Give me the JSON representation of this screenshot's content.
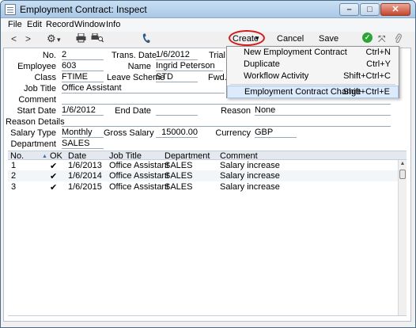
{
  "window": {
    "title": "Employment Contract: Inspect"
  },
  "menubar": {
    "items": [
      "File",
      "Edit",
      "Record",
      "Window",
      "Info"
    ]
  },
  "toolbar": {
    "prev": "<",
    "next": ">",
    "gear_arrow": "▾",
    "create": "Create",
    "create_arrow": "▾",
    "cancel": "Cancel",
    "save": "Save"
  },
  "icons": {
    "ok": "ok-icon"
  },
  "form": {
    "no": {
      "label": "No.",
      "value": "2"
    },
    "trans_date": {
      "label": "Trans. Date",
      "value": "1/6/2012"
    },
    "trial": {
      "label": "Trial"
    },
    "employee": {
      "label": "Employee",
      "value": "603"
    },
    "name": {
      "label": "Name",
      "value": "Ingrid Peterson"
    },
    "class": {
      "label": "Class",
      "value": "FTIME"
    },
    "leave_scheme": {
      "label": "Leave Scheme",
      "value": "STD"
    },
    "fwd": {
      "label": "Fwd."
    },
    "job_title": {
      "label": "Job Title",
      "value": "Office Assistant"
    },
    "comment": {
      "label": "Comment",
      "value": ""
    },
    "start_date": {
      "label": "Start Date",
      "value": "1/6/2012"
    },
    "end_date": {
      "label": "End Date",
      "value": ""
    },
    "reason": {
      "label": "Reason",
      "value": "None"
    },
    "reason_details": {
      "label": "Reason Details",
      "value": ""
    },
    "salary_type": {
      "label": "Salary Type",
      "value": "Monthly"
    },
    "gross_salary": {
      "label": "Gross Salary",
      "value": "15000.00"
    },
    "currency": {
      "label": "Currency",
      "value": "GBP"
    },
    "department": {
      "label": "Department",
      "value": "SALES"
    }
  },
  "create_menu": {
    "items": [
      {
        "label": "New Employment Contract",
        "shortcut": "Ctrl+N"
      },
      {
        "label": "Duplicate",
        "shortcut": "Ctrl+Y"
      },
      {
        "label": "Workflow Activity",
        "shortcut": "Shift+Ctrl+C"
      },
      {
        "label": "Employment Contract Change",
        "shortcut": "Shift+Ctrl+E"
      }
    ]
  },
  "grid": {
    "columns": [
      "No.",
      "OK",
      "Date",
      "Job Title",
      "Department",
      "Comment"
    ],
    "sort_arrow": "▲",
    "rows": [
      {
        "no": "1",
        "ok": "✔",
        "date": "1/6/2013",
        "job_title": "Office Assistant",
        "department": "SALES",
        "comment": "Salary increase"
      },
      {
        "no": "2",
        "ok": "✔",
        "date": "1/6/2014",
        "job_title": "Office Assistant",
        "department": "SALES",
        "comment": "Salary increase"
      },
      {
        "no": "3",
        "ok": "✔",
        "date": "1/6/2015",
        "job_title": "Office Assistant",
        "department": "SALES",
        "comment": "Salary increase"
      }
    ]
  },
  "scrollbar": {
    "up": "▲"
  }
}
